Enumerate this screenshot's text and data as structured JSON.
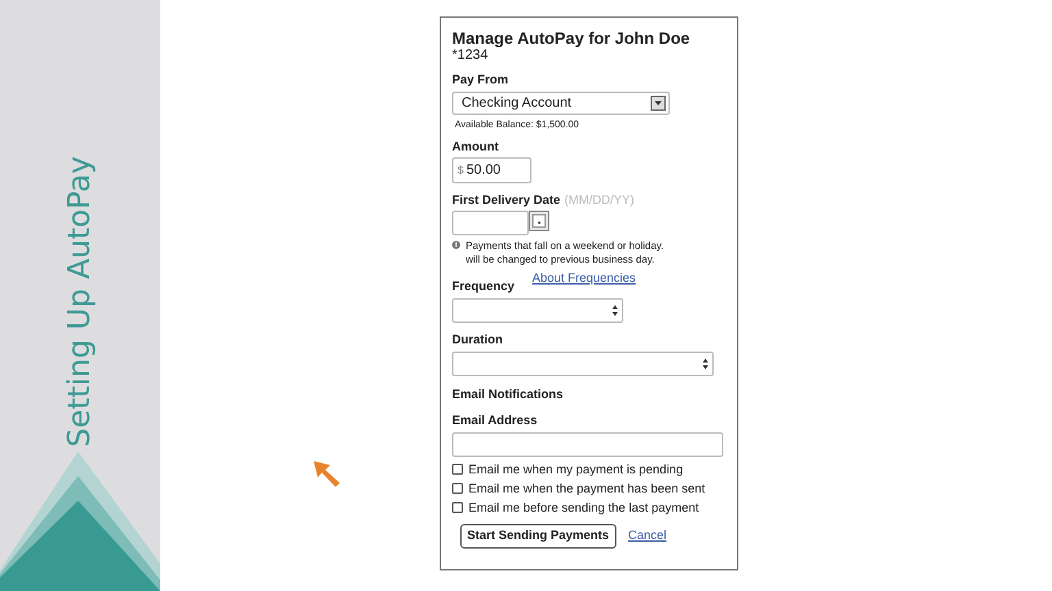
{
  "slide": {
    "title": "Setting Up AutoPay"
  },
  "form": {
    "title": "Manage AutoPay for John Doe",
    "account": "*1234",
    "pay_from": {
      "label": "Pay From",
      "value": "Checking Account",
      "balance": "Available Balance: $1,500.00"
    },
    "amount": {
      "label": "Amount",
      "prefix": "$",
      "value": "50.00"
    },
    "first_delivery_date": {
      "label": "First Delivery Date",
      "hint": "(MM/DD/YY)"
    },
    "note": "Payments that fall on a weekend or holiday. will be changed to previous business day.",
    "frequency": {
      "label": "Frequency",
      "link": "About Frequencies"
    },
    "duration": {
      "label": "Duration"
    },
    "email_notifications": "Email Notifications",
    "email_address": {
      "label": "Email Address"
    },
    "options": [
      {
        "label": "Email me when my payment is pending",
        "checked": false
      },
      {
        "label": "Email me when the payment has been sent",
        "checked": false
      },
      {
        "label": "Email me before sending the last payment",
        "checked": false
      }
    ],
    "buttons": [
      {
        "kind": "primary",
        "label": "Start Sending Payments"
      },
      {
        "kind": "link",
        "label": "Cancel"
      }
    ]
  }
}
